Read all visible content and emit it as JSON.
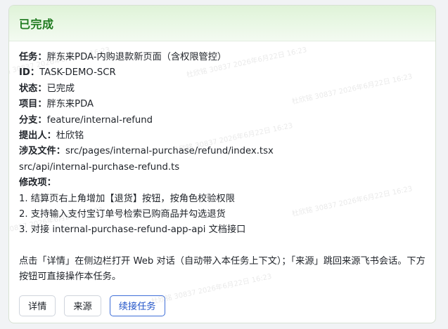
{
  "card": {
    "status_title": "已完成",
    "fields": {
      "task_label": "任务",
      "task_value": "胖东来PDA-内购退款新页面（含权限管控）",
      "id_label": "ID",
      "id_value": "TASK-DEMO-SCR",
      "status_label": "状态",
      "status_value": "已完成",
      "project_label": "项目",
      "project_value": "胖东来PDA",
      "branch_label": "分支",
      "branch_value": "feature/internal-refund",
      "proposer_label": "提出人",
      "proposer_value": "杜欣铭",
      "files_label": "涉及文件",
      "files": [
        "src/pages/internal-purchase/refund/index.tsx",
        "src/api/internal-purchase-refund.ts"
      ],
      "changes_label": "修改项",
      "changes": [
        "1. 结算页右上角增加【退货】按钮，按角色校验权限",
        "2. 支持输入支付宝订单号检索已购商品并勾选退货",
        "3. 对接 internal-purchase-refund-app-api 文档接口"
      ],
      "colon": "："
    },
    "note": "点击「详情」在侧边栏打开 Web 对话（自动带入本任务上下文）；「来源」跳回来源飞书会话。下方按钮可直接操作本任务。",
    "buttons": {
      "details": "详情",
      "source": "来源",
      "continue": "续接任务"
    }
  },
  "watermark_text": "杜欣铭 30837 2026年6月22日 16:23",
  "colors": {
    "header_bg": "#e3f5dd",
    "status_green": "#1f7a1f",
    "primary_blue": "#2456c9"
  }
}
